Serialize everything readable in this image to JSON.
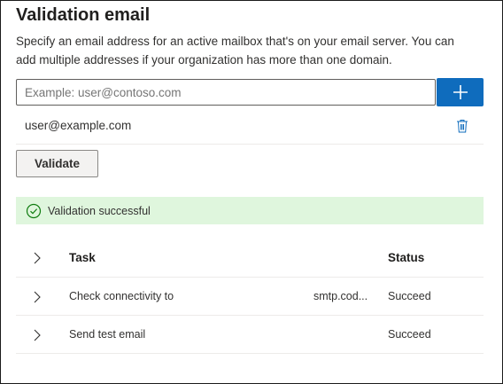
{
  "panel": {
    "title": "Validation email",
    "description": "Specify an email address for an active mailbox that's on your email server. You can add multiple addresses if your organization has more than one domain."
  },
  "email_input": {
    "placeholder": "Example: user@contoso.com",
    "value": ""
  },
  "add_button": {
    "icon": "plus-icon",
    "color": "#0f6cbd"
  },
  "emails": [
    {
      "address": "user@example.com",
      "delete_icon": "trash-icon"
    }
  ],
  "validate_button": {
    "label": "Validate"
  },
  "status_banner": {
    "message": "Validation successful",
    "icon": "checkmark-circle-icon",
    "background": "#dff6dd",
    "icon_color": "#107c10"
  },
  "tasks_table": {
    "columns": {
      "task": "Task",
      "status": "Status"
    },
    "rows": [
      {
        "task": "Check connectivity to",
        "target": "smtp.cod...",
        "status": "Succeed"
      },
      {
        "task": "Send test email",
        "target": "",
        "status": "Succeed"
      }
    ]
  }
}
